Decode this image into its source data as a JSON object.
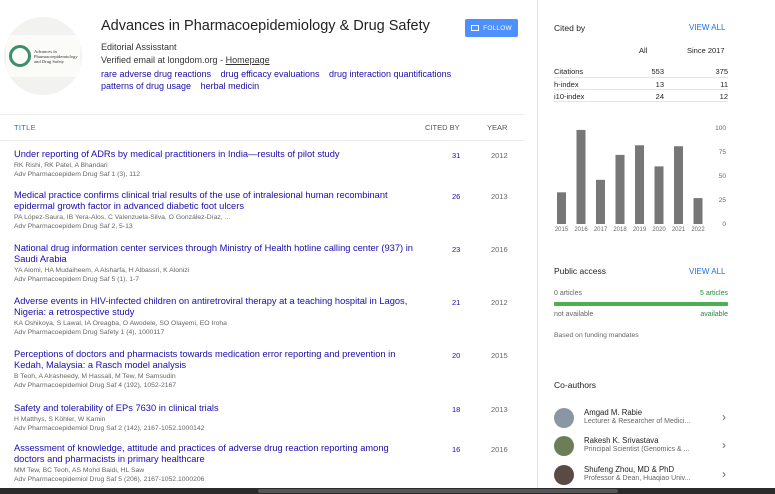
{
  "profile": {
    "avatar_text": [
      "Advances in",
      "Pharmacoepidemiology",
      "and Drug Safety"
    ],
    "name": "Advances in Pharmacoepidemiology & Drug Safety",
    "affiliation": "Editorial Assisstant",
    "email_prefix": "Verified email at longdom.org - ",
    "homepage": "Homepage",
    "follow": "FOLLOW",
    "interests": [
      "rare adverse drug reactions",
      "drug efficacy evaluations",
      "drug interaction quantifications",
      "patterns of drug usage",
      "herbal medicin"
    ]
  },
  "table": {
    "col_title": "TITLE",
    "col_cited": "CITED BY",
    "col_year": "YEAR",
    "articles": [
      {
        "title": "Under reporting of ADRs by medical practitioners in India—results of pilot study",
        "authors": "RK Rishi, RK Patel, A Bhandari",
        "venue": "Adv Pharmacoepidem Drug Saf 1 (3), 112",
        "cited": "31",
        "year": "2012"
      },
      {
        "title": "Medical practice confirms clinical trial results of the use of intralesional human recombinant epidermal growth factor in advanced diabetic foot ulcers",
        "authors": "PA López-Saura, IB Yera-Alos, C Valenzuela-Silva, O González-Díaz, ...",
        "venue": "Adv Pharmacoepidem Drug Saf 2, 5-13",
        "cited": "26",
        "year": "2013"
      },
      {
        "title": "National drug information center services through Ministry of Health hotline calling center (937) in Saudi Arabia",
        "authors": "YA Alomi, HA Mudaiheem, A Alsharfa, H Albassri, K Alonizi",
        "venue": "Adv Pharmacoepidem Drug Saf 5 (1), 1-7",
        "cited": "23",
        "year": "2016"
      },
      {
        "title": "Adverse events in HIV-infected children on antiretroviral therapy at a teaching hospital in Lagos, Nigeria: a retrospective study",
        "authors": "KA Oshikoya, S Lawal, IA Oreagba, O Awodele, SO Olayemi, EO Iroha",
        "venue": "Adv Pharmacoepidem Drug Safety 1 (4), 1000117",
        "cited": "21",
        "year": "2012"
      },
      {
        "title": "Perceptions of doctors and pharmacists towards medication error reporting and prevention in Kedah, Malaysia: a Rasch model analysis",
        "authors": "B Teoh, A Alrasheedy, M Hassali, M Tew, M Samsudin",
        "venue": "Adv Pharmacoepidemiol Drug Saf 4 (192), 1052-2167",
        "cited": "20",
        "year": "2015"
      },
      {
        "title": "Safety and tolerability of EPs 7630 in clinical trials",
        "authors": "H Matthys, S Köhler, W Kamin",
        "venue": "Adv Pharmacoepidemiol Drug Saf 2 (142), 2167-1052.1000142",
        "cited": "18",
        "year": "2013"
      },
      {
        "title": "Assessment of knowledge, attitude and practices of adverse drug reaction reporting among doctors and pharmacists in primary healthcare",
        "authors": "MM Tew, BC Teoh, AS Mohd Baidi, HL Saw",
        "venue": "Adv Pharmacoepidemiol Drug Saf 5 (206), 2167-1052.1000206",
        "cited": "16",
        "year": "2016"
      }
    ]
  },
  "cited_by": {
    "label": "Cited by",
    "view_all": "VIEW ALL",
    "col_all": "All",
    "col_since": "Since 2017",
    "rows": [
      {
        "label": "Citations",
        "all": "553",
        "since": "375"
      },
      {
        "label": "h-index",
        "all": "13",
        "since": "11"
      },
      {
        "label": "i10-index",
        "all": "24",
        "since": "12"
      }
    ]
  },
  "chart_data": {
    "type": "bar",
    "categories": [
      "2015",
      "2016",
      "2017",
      "2018",
      "2019",
      "2020",
      "2021",
      "2022"
    ],
    "values": [
      33,
      98,
      46,
      72,
      82,
      60,
      81,
      27
    ],
    "ylim": [
      0,
      100
    ],
    "yticks": [
      "100",
      "75",
      "50",
      "25",
      "0"
    ],
    "color": "#777777"
  },
  "public_access": {
    "label": "Public access",
    "view_all": "VIEW ALL",
    "not_avail_count": "0 articles",
    "avail_count": "5 articles",
    "not_avail": "not available",
    "avail": "available",
    "note": "Based on funding mandates"
  },
  "coauthors": {
    "label": "Co-authors",
    "items": [
      {
        "name": "Amgad M. Rabie",
        "aff": "Lecturer & Researcher of Medici..."
      },
      {
        "name": "Rakesh K. Srivastava",
        "aff": "Principal Scientist (Genomics & ..."
      },
      {
        "name": "Shufeng Zhou, MD & PhD",
        "aff": "Professor & Dean, Huaqiao Univ..."
      }
    ]
  }
}
